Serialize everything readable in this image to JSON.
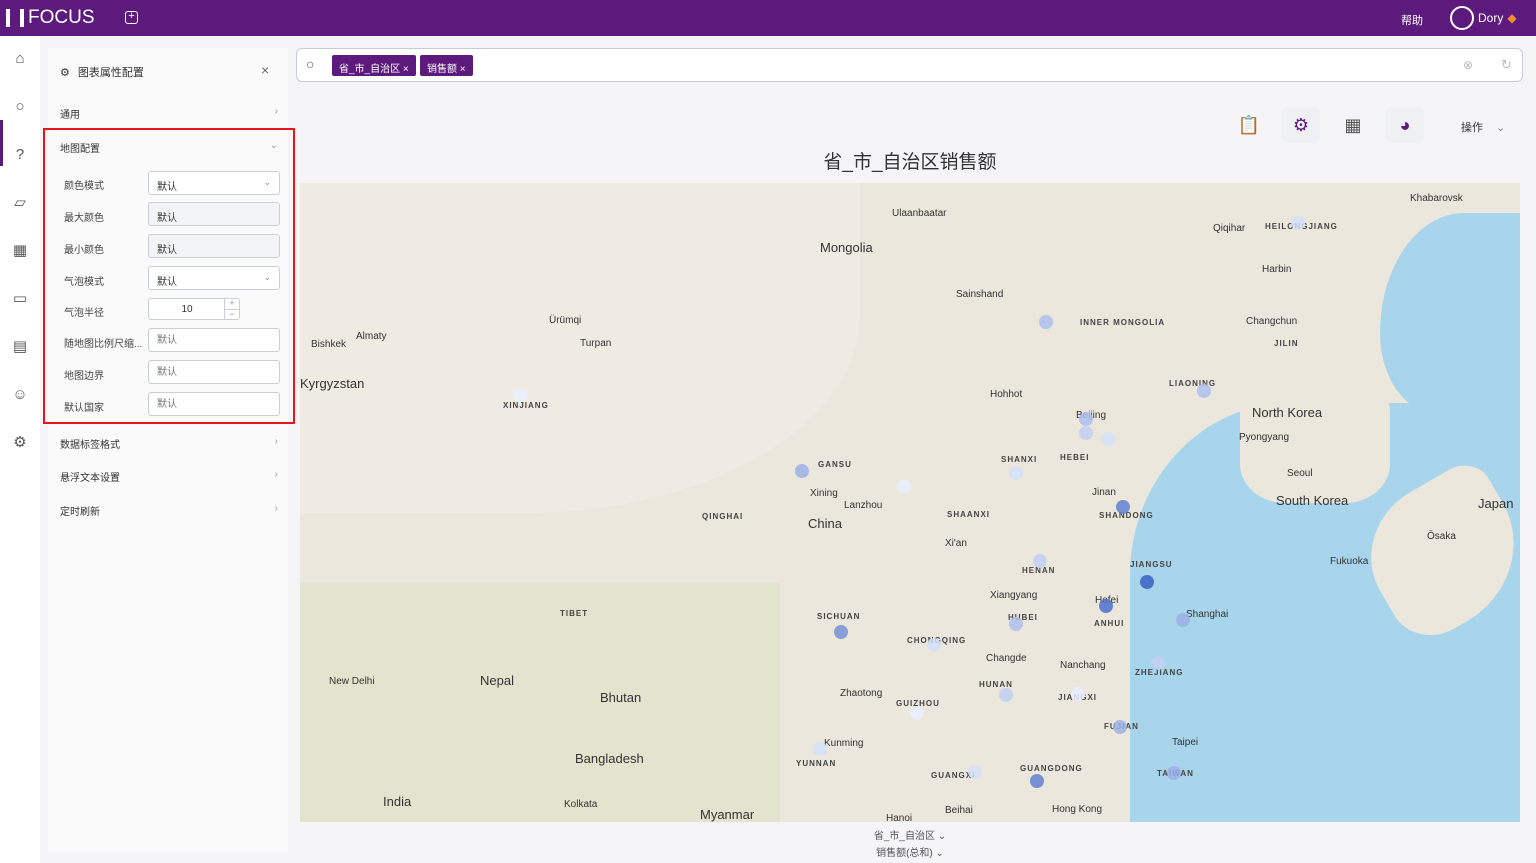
{
  "app": {
    "logo": "FOCUS",
    "help": "帮助",
    "user": "Dory"
  },
  "panel": {
    "title": "图表属性配置",
    "sections": {
      "general": "通用",
      "map": "地图配置",
      "label": "数据标签格式",
      "hover": "悬浮文本设置",
      "refresh": "定时刷新"
    },
    "fields": [
      {
        "label": "颜色模式",
        "value": "默认",
        "type": "select"
      },
      {
        "label": "最大颜色",
        "value": "默认",
        "type": "readonly"
      },
      {
        "label": "最小颜色",
        "value": "默认",
        "type": "readonly"
      },
      {
        "label": "气泡模式",
        "value": "默认",
        "type": "select"
      },
      {
        "label": "气泡半径",
        "value": "10",
        "type": "stepper"
      },
      {
        "label": "随地图比例尺缩...",
        "placeholder": "默认",
        "type": "input"
      },
      {
        "label": "地图边界",
        "placeholder": "默认",
        "type": "input"
      },
      {
        "label": "默认国家",
        "placeholder": "默认",
        "type": "input"
      }
    ]
  },
  "search": {
    "tags": [
      "省_市_自治区",
      "销售额"
    ]
  },
  "toolbar": {
    "ops": "操作"
  },
  "chart": {
    "title": "省_市_自治区销售额",
    "legend": [
      "省_市_自治区",
      "销售额(总和)"
    ],
    "accent": "#5c1a7d"
  },
  "map_labels": {
    "countries": [
      "Mongolia",
      "China",
      "Nepal",
      "Bhutan",
      "Bangladesh",
      "India",
      "Myanmar",
      "North Korea",
      "South Korea",
      "Japan",
      "Kyrgyzstan"
    ],
    "provinces": [
      "XINJIANG",
      "GANSU",
      "QINGHAI",
      "TIBET",
      "SICHUAN",
      "INNER MONGOLIA",
      "HEILONGJIANG",
      "JILIN",
      "LIAONING",
      "HEBEI",
      "SHANXI",
      "SHAANXI",
      "HENAN",
      "SHANDONG",
      "JIANGSU",
      "ANHUI",
      "HUBEI",
      "CHONGQING",
      "HUNAN",
      "JIANGXI",
      "ZHEJIANG",
      "FUJIAN",
      "GUIZHOU",
      "YUNNAN",
      "GUANGXI",
      "GUANGDONG",
      "TAIWAN"
    ],
    "cities": [
      "Ulaanbaatar",
      "Ürümqi",
      "Turpan",
      "Almaty",
      "Bishkek",
      "Hohhot",
      "Beijing",
      "Xining",
      "Lanzhou",
      "Xi'an",
      "Jinan",
      "Hefei",
      "Shanghai",
      "Xiangyang",
      "Changde",
      "Nanchang",
      "Zhaotong",
      "Kunming",
      "Hong Kong",
      "Taipei",
      "Harbin",
      "Changchun",
      "Pyongyang",
      "Seoul",
      "Qiqihar",
      "Sainshand",
      "New Delhi",
      "Kolkata",
      "Khabarovsk",
      "Ōsaka",
      "Fukuoka",
      "Hanoi",
      "Beihai"
    ]
  },
  "bubbles": [
    {
      "region": "Inner Mongolia",
      "level": 0.3
    },
    {
      "region": "Heilongjiang",
      "level": 0.1
    },
    {
      "region": "Liaoning",
      "level": 0.3
    },
    {
      "region": "Beijing",
      "level": 0.3
    },
    {
      "region": "Tianjin",
      "level": 0.1
    },
    {
      "region": "Hebei",
      "level": 0.2
    },
    {
      "region": "Gansu",
      "level": 0.4
    },
    {
      "region": "Ningxia",
      "level": 0.0
    },
    {
      "region": "Shandong",
      "level": 0.7
    },
    {
      "region": "Jiangsu",
      "level": 0.9
    },
    {
      "region": "Anhui",
      "level": 0.8
    },
    {
      "region": "Shanghai",
      "level": 0.4
    },
    {
      "region": "Henan",
      "level": 0.2
    },
    {
      "region": "Hubei",
      "level": 0.3
    },
    {
      "region": "Sichuan",
      "level": 0.6
    },
    {
      "region": "Chongqing",
      "level": 0.1
    },
    {
      "region": "Hunan",
      "level": 0.2
    },
    {
      "region": "Zhejiang",
      "level": 0.2
    },
    {
      "region": "Jiangxi",
      "level": 0.0
    },
    {
      "region": "Fujian",
      "level": 0.4
    },
    {
      "region": "Guizhou",
      "level": 0.0
    },
    {
      "region": "Yunnan",
      "level": 0.1
    },
    {
      "region": "Guangxi",
      "level": 0.1
    },
    {
      "region": "Guangdong",
      "level": 0.7
    },
    {
      "region": "Taiwan",
      "level": 0.4
    },
    {
      "region": "Xinjiang",
      "level": 0.0
    },
    {
      "region": "Shaanxi",
      "level": 0.1
    }
  ]
}
